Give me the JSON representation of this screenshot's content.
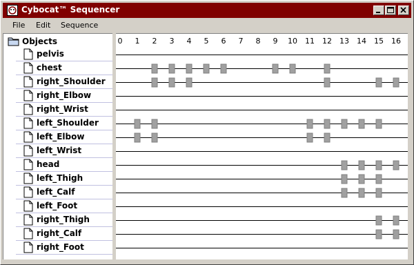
{
  "window": {
    "title": "Cybocat™ Sequencer",
    "buttons": {
      "minimize": "minimize",
      "maximize": "maximize",
      "close": "close"
    }
  },
  "menu": {
    "file": "File",
    "edit": "Edit",
    "sequence": "Sequence"
  },
  "tree": {
    "root_label": "Objects",
    "items": [
      {
        "label": "pelvis",
        "keys": []
      },
      {
        "label": "chest",
        "keys": [
          2,
          3,
          4,
          5,
          6,
          9,
          10,
          12
        ]
      },
      {
        "label": "right_Shoulder",
        "keys": [
          2,
          3,
          4,
          12,
          15,
          16
        ]
      },
      {
        "label": "right_Elbow",
        "keys": []
      },
      {
        "label": "right_Wrist",
        "keys": []
      },
      {
        "label": "left_Shoulder",
        "keys": [
          1,
          2,
          11,
          12,
          13,
          14,
          15
        ]
      },
      {
        "label": "left_Elbow",
        "keys": [
          1,
          2,
          11,
          12
        ]
      },
      {
        "label": "left_Wrist",
        "keys": []
      },
      {
        "label": "head",
        "keys": [
          13,
          14,
          15,
          16
        ]
      },
      {
        "label": "left_Thigh",
        "keys": [
          13,
          14,
          15
        ]
      },
      {
        "label": "left_Calf",
        "keys": [
          13,
          14,
          15
        ]
      },
      {
        "label": "left_Foot",
        "keys": []
      },
      {
        "label": "right_Thigh",
        "keys": [
          15,
          16
        ]
      },
      {
        "label": "right_Calf",
        "keys": [
          15,
          16
        ]
      },
      {
        "label": "right_Foot",
        "keys": []
      }
    ]
  },
  "timeline": {
    "ticks": [
      "0",
      "1",
      "2",
      "3",
      "4",
      "5",
      "6",
      "7",
      "8",
      "9",
      "10",
      "11",
      "12",
      "13",
      "14",
      "15",
      "16"
    ]
  },
  "colors": {
    "titlebar": "#800000",
    "keyframe_fill": "#a0a0a0",
    "track_line": "#000000",
    "separator": "#c0c0e0"
  }
}
